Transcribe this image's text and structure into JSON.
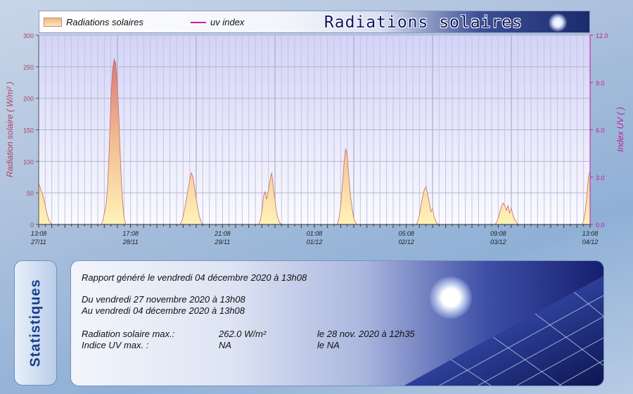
{
  "chart_data": {
    "type": "area",
    "title": "Radiations solaires",
    "legend": [
      "Radiations solaires",
      "uv index"
    ],
    "ylabel": "Radiation solaire ( W/m² )",
    "y2label": "Index UV ( )",
    "ylim": [
      0,
      300
    ],
    "y2lim": [
      0,
      12
    ],
    "yticks": [
      "0",
      "50",
      "100",
      "150",
      "200",
      "250",
      "300"
    ],
    "y2ticks": [
      "0.0",
      "3.0",
      "6.0",
      "9.0",
      "12.0"
    ],
    "xticks": [
      {
        "time": "13:08",
        "date": "27/11"
      },
      {
        "time": "17:08",
        "date": "28/11"
      },
      {
        "time": "21:08",
        "date": "29/11"
      },
      {
        "time": "01:08",
        "date": "01/12"
      },
      {
        "time": "05:08",
        "date": "02/12"
      },
      {
        "time": "09:08",
        "date": "03/12"
      },
      {
        "time": "13:08",
        "date": "04/12"
      }
    ],
    "x_range_hours": [
      0,
      168
    ],
    "grid": true,
    "series": [
      {
        "name": "Radiations solaires",
        "color": "#e8a67a",
        "x_hours": [
          0,
          0.5,
          1,
          1.5,
          2,
          2.5,
          3,
          3.5,
          4,
          4.5,
          19,
          19.5,
          20,
          20.5,
          21,
          21.5,
          22,
          22.5,
          23,
          23.5,
          24,
          24.5,
          25,
          25.5,
          26,
          26.5,
          43,
          43.5,
          44,
          44.5,
          45,
          45.5,
          46,
          46.5,
          47,
          47.5,
          48,
          48.5,
          49,
          49.5,
          50,
          67,
          67.5,
          68,
          68.5,
          69,
          69.5,
          70,
          70.5,
          71,
          71.5,
          72,
          72.5,
          73,
          73.5,
          74,
          91,
          91.5,
          92,
          92.5,
          93,
          93.5,
          94,
          94.5,
          95,
          95.5,
          96,
          96.5,
          97,
          97.5,
          98,
          115,
          115.5,
          116,
          116.5,
          117,
          117.5,
          118,
          118.5,
          119,
          119.5,
          120,
          120.5,
          121,
          121.5,
          122,
          139,
          139.5,
          140,
          140.5,
          141,
          141.5,
          142,
          142.5,
          143,
          143.5,
          144,
          144.5,
          145,
          145.5,
          146,
          163,
          163.5,
          164,
          164.5,
          165,
          165.5,
          166,
          166.5,
          167,
          167.5,
          168
        ],
        "values": [
          65,
          58,
          50,
          42,
          30,
          18,
          8,
          3,
          0,
          0,
          0,
          5,
          18,
          30,
          60,
          120,
          200,
          245,
          262,
          255,
          220,
          160,
          90,
          40,
          12,
          0,
          0,
          4,
          12,
          25,
          40,
          55,
          70,
          82,
          75,
          58,
          40,
          25,
          12,
          4,
          0,
          0,
          6,
          20,
          45,
          52,
          40,
          55,
          70,
          82,
          58,
          38,
          18,
          8,
          2,
          0,
          0,
          10,
          30,
          60,
          95,
          120,
          110,
          75,
          45,
          25,
          10,
          3,
          0,
          0,
          0,
          0,
          5,
          15,
          30,
          45,
          55,
          60,
          48,
          35,
          20,
          25,
          12,
          5,
          1,
          0,
          0,
          3,
          10,
          20,
          28,
          34,
          30,
          22,
          30,
          18,
          26,
          14,
          8,
          4,
          0,
          0,
          0,
          0,
          0,
          0,
          0,
          5,
          20,
          45,
          75,
          85
        ]
      },
      {
        "name": "uv index",
        "color": "#d11aa8",
        "values": []
      }
    ]
  },
  "stats": {
    "tab_label": "Statistiques",
    "generated": "Rapport généré le vendredi 04 décembre 2020 à 13h08",
    "from": "Du vendredi 27 novembre 2020 à 13h08",
    "to": "Au vendredi 04 décembre 2020 à 13h08",
    "rad_label": "Radiation solaire max.:",
    "rad_value": "262.0 W/m²",
    "rad_date": "le 28 nov. 2020 à 12h35",
    "uv_label": "Indice UV max. :",
    "uv_value": "NA",
    "uv_date": "le NA"
  }
}
